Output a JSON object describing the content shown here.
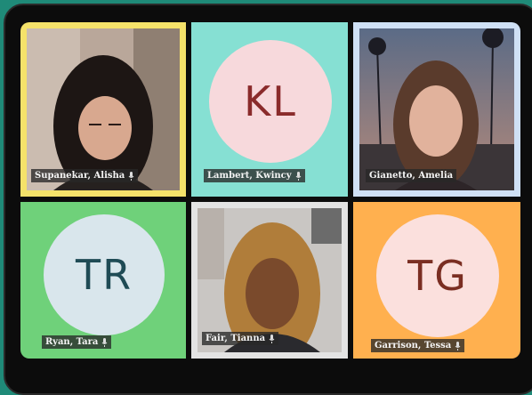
{
  "participants": [
    {
      "name": "Supanekar, Alisha",
      "border_color": "#f5e26a",
      "type": "video"
    },
    {
      "name": "Lambert, Kwincy",
      "initials": "KL",
      "tile_color": "#86e0d3",
      "avatar_color": "#f7d9dc",
      "initials_color": "#8a2b2b",
      "type": "initials"
    },
    {
      "name": "Gianetto, Amelia",
      "border_color": "#cfe0f5",
      "type": "video"
    },
    {
      "name": "Ryan, Tara",
      "initials": "TR",
      "tile_color": "#6fd17a",
      "avatar_color": "#d9e6ec",
      "initials_color": "#1f4b55",
      "type": "initials"
    },
    {
      "name": "Fair, Tianna",
      "border_color": "#e3e3e3",
      "type": "video"
    },
    {
      "name": "Garrison, Tessa",
      "initials": "TG",
      "tile_color": "#ffb04f",
      "avatar_color": "#fbe0dd",
      "initials_color": "#7a2e22",
      "type": "initials"
    }
  ],
  "icons": {
    "mic": "microphone-icon"
  }
}
